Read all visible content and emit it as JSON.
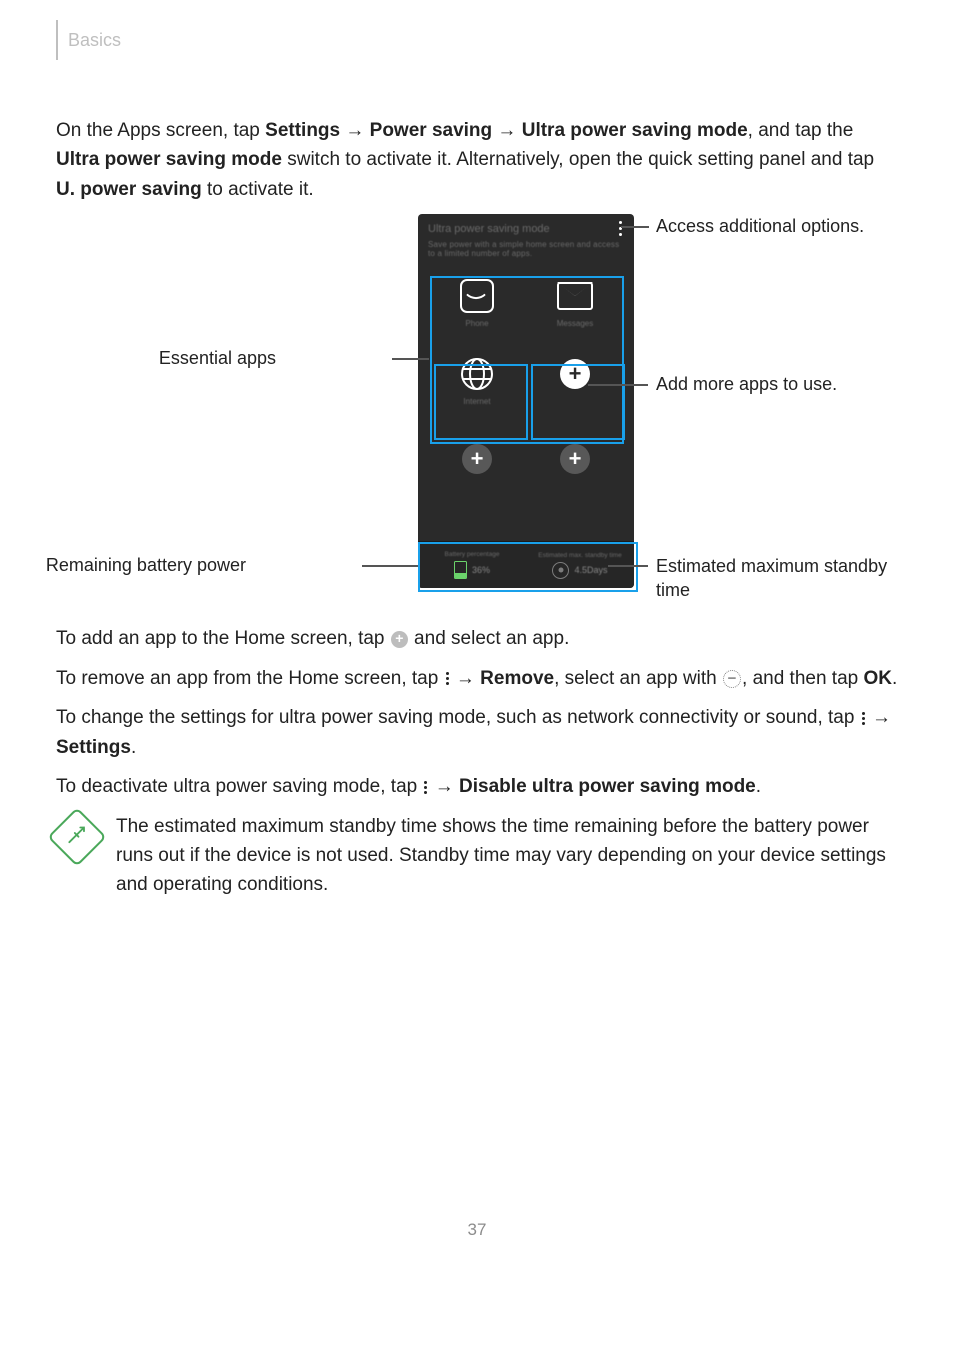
{
  "header": {
    "section": "Basics"
  },
  "intro": {
    "prefix": "On the Apps screen, tap ",
    "path1a": "Settings",
    "arrow1": " → ",
    "path1b": "Power saving",
    "arrow2": " → ",
    "path1c": "Ultra power saving mode",
    "cont1": ", and tap the ",
    "path2": "Ultra power saving mode",
    "cont2": " switch to activate it. Alternatively, open the quick setting panel and tap ",
    "path3": "U. power saving",
    "cont3": " to activate it."
  },
  "callouts": {
    "additional_options": "Access additional options.",
    "essential_apps": "Essential apps",
    "add_more": "Add more apps to use.",
    "remaining_battery": "Remaining battery power",
    "standby": "Estimated maximum standby time"
  },
  "screen": {
    "title": "Ultra power saving mode",
    "subtitle": "Save power with a simple home screen and access to a limited number of apps.",
    "apps": {
      "phone": "Phone",
      "messages": "Messages",
      "internet": "Internet"
    },
    "footer": {
      "batt_label": "Battery percentage",
      "batt_value": "36%",
      "standby_label": "Estimated max. standby time",
      "standby_value": "4.5Days"
    }
  },
  "para_add": {
    "a": "To add an app to the Home screen, tap ",
    "b": " and select an app."
  },
  "para_remove": {
    "a": "To remove an app from the Home screen, tap ",
    "b": " → ",
    "c": "Remove",
    "d": ", select an app with ",
    "e": ", and then tap ",
    "f": "OK",
    "g": "."
  },
  "para_settings": {
    "a": "To change the settings for ultra power saving mode, such as network connectivity or sound, tap ",
    "b": " → ",
    "c": "Settings",
    "d": "."
  },
  "para_disable": {
    "a": "To deactivate ultra power saving mode, tap ",
    "b": " → ",
    "c": "Disable ultra power saving mode",
    "d": "."
  },
  "note": "The estimated maximum standby time shows the time remaining before the battery power runs out if the device is not used. Standby time may vary depending on your device settings and operating conditions.",
  "page_number": "37"
}
